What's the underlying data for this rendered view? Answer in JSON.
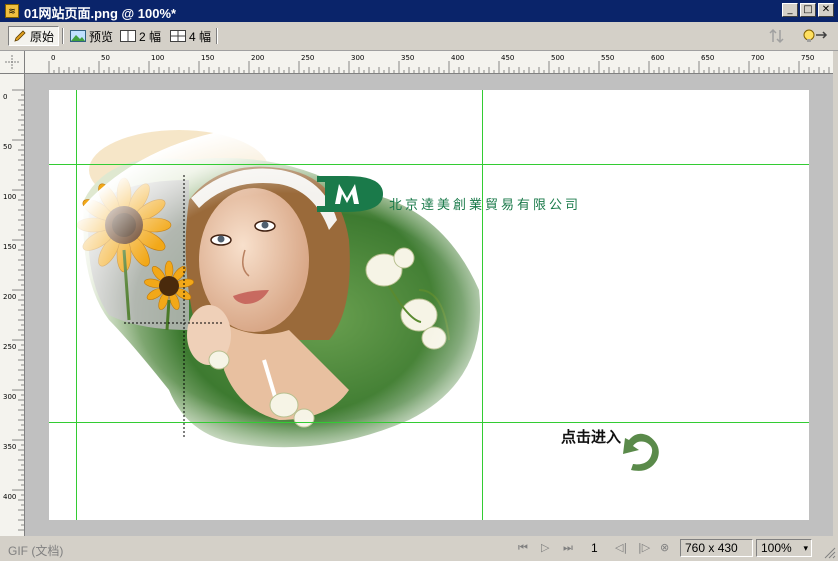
{
  "window": {
    "title": "01网站页面.png @ 100%*",
    "icon": "fireworks-doc-icon",
    "controls": [
      "minimize",
      "maximize",
      "close"
    ]
  },
  "toolbar": {
    "original_label": "原始",
    "preview_label": "预览",
    "two_up_label": "2 幅",
    "four_up_label": "4 幅"
  },
  "ruler": {
    "h_labels": [
      "0",
      "50",
      "100",
      "150",
      "200",
      "250",
      "300",
      "350",
      "400",
      "450",
      "500",
      "550",
      "600",
      "650",
      "700",
      "750"
    ],
    "v_labels": [
      "0",
      "50",
      "100",
      "150",
      "200",
      "250",
      "300",
      "350",
      "400"
    ]
  },
  "document": {
    "company_name": "北京達美創業貿易有限公司",
    "logo_letters": "DM",
    "enter_text": "点击进入",
    "colors": {
      "brand_green": "#1a7a4a",
      "guide": "#33cc33",
      "arrow": "#5a8a4a"
    }
  },
  "status": {
    "format_label": "GIF (文档)",
    "frame_number": "1",
    "dimensions": "760 x 430",
    "zoom": "100%"
  }
}
